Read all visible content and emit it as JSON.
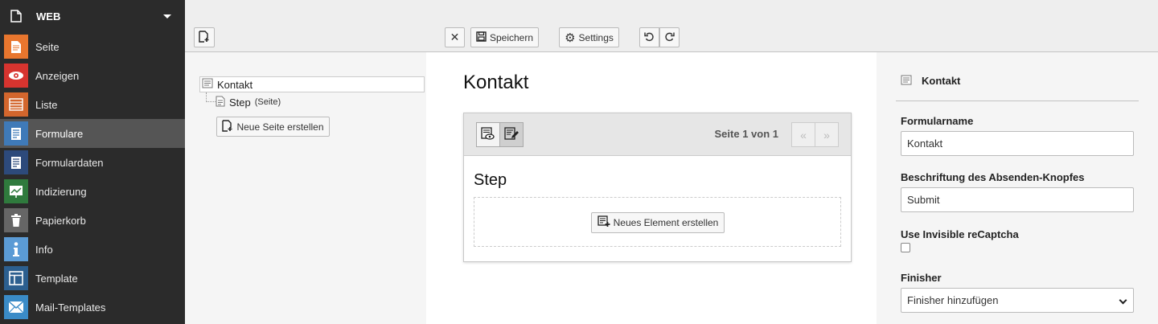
{
  "sidebar": {
    "group_label": "WEB",
    "items": [
      {
        "label": "Seite",
        "color": "#e8762e"
      },
      {
        "label": "Anzeigen",
        "color": "#d7342f"
      },
      {
        "label": "Liste",
        "color": "#d3662d"
      },
      {
        "label": "Formulare",
        "color": "#3f7ab8"
      },
      {
        "label": "Formulardaten",
        "color": "#2d4a7b"
      },
      {
        "label": "Indizierung",
        "color": "#2f7a3d"
      },
      {
        "label": "Papierkorb",
        "color": "#666666"
      },
      {
        "label": "Info",
        "color": "#5b9bd5"
      },
      {
        "label": "Template",
        "color": "#2c5f8f"
      },
      {
        "label": "Mail-Templates",
        "color": "#3a8bc7"
      }
    ],
    "active_index": 3
  },
  "toolbar": {
    "save_label": "Speichern",
    "settings_label": "Settings"
  },
  "tree": {
    "root_label": "Kontakt",
    "child_label": "Step",
    "child_sub": "(Seite)",
    "new_page_label": "Neue Seite erstellen"
  },
  "stage": {
    "title": "Kontakt",
    "pager_text": "Seite 1 von 1",
    "step_title": "Step",
    "new_element_label": "Neues Element erstellen"
  },
  "inspector": {
    "title": "Kontakt",
    "form_name_label": "Formularname",
    "form_name_value": "Kontakt",
    "submit_label": "Beschriftung des Absenden-Knopfes",
    "submit_value": "Submit",
    "recaptcha_label": "Use Invisible reCaptcha",
    "finisher_label": "Finisher",
    "finisher_select": "Finisher hinzufügen"
  }
}
